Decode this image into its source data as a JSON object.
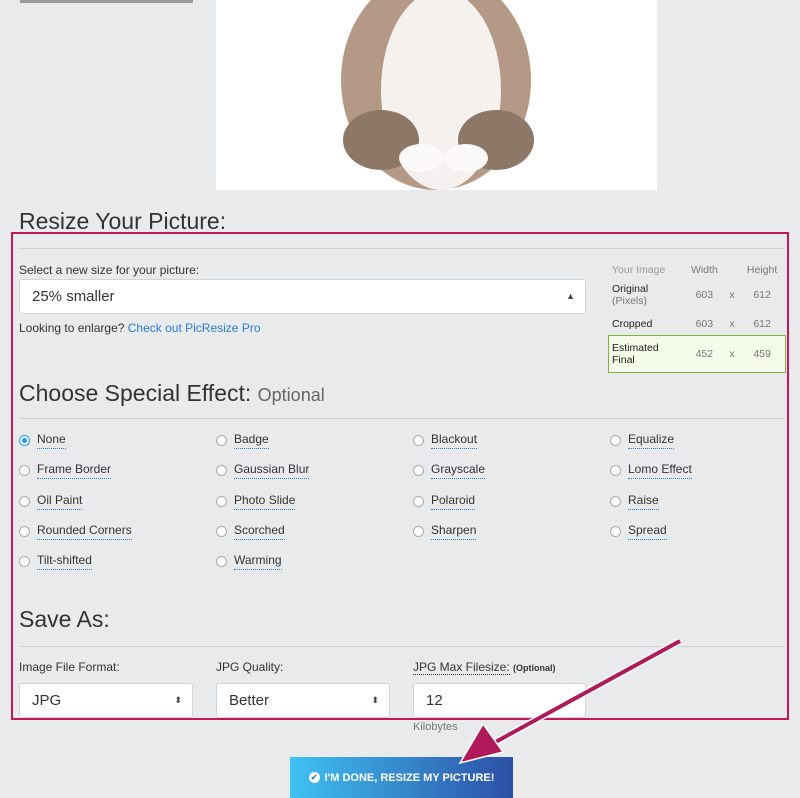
{
  "resize": {
    "heading": "Resize Your Picture:",
    "select_label": "Select a new size for your picture:",
    "size_value": "25% smaller",
    "enlarge_text": "Looking to enlarge?",
    "enlarge_link": "Check out PicResize Pro",
    "table": {
      "headers": [
        "Your Image",
        "Width",
        "",
        "Height"
      ],
      "rows": [
        {
          "label": "Original",
          "sub": "(Pixels)",
          "w": "603",
          "x": "x",
          "h": "612"
        },
        {
          "label": "Cropped",
          "sub": "",
          "w": "603",
          "x": "x",
          "h": "612"
        },
        {
          "label": "Estimated",
          "sub": "Final",
          "w": "452",
          "x": "x",
          "h": "459"
        }
      ]
    }
  },
  "effects": {
    "heading": "Choose Special Effect:",
    "optional": "Optional",
    "selected": "None",
    "options": [
      "None",
      "Badge",
      "Blackout",
      "Equalize",
      "Frame Border",
      "Gaussian Blur",
      "Grayscale",
      "Lomo Effect",
      "Oil Paint",
      "Photo Slide",
      "Polaroid",
      "Raise",
      "Rounded Corners",
      "Scorched",
      "Sharpen",
      "Spread",
      "Tilt-shifted",
      "Warming"
    ]
  },
  "save": {
    "heading": "Save As:",
    "format_label": "Image File Format:",
    "format_value": "JPG",
    "quality_label": "JPG Quality:",
    "quality_value": "Better",
    "filesize_label": "JPG Max Filesize:",
    "filesize_optional": "(Optional)",
    "filesize_value": "12",
    "filesize_unit": "Kilobytes"
  },
  "submit": {
    "label": "I'M DONE, RESIZE MY PICTURE!"
  },
  "colors": {
    "highlight_border": "#c2185b",
    "arrow": "#b0195a",
    "accent": "#2196f3"
  }
}
